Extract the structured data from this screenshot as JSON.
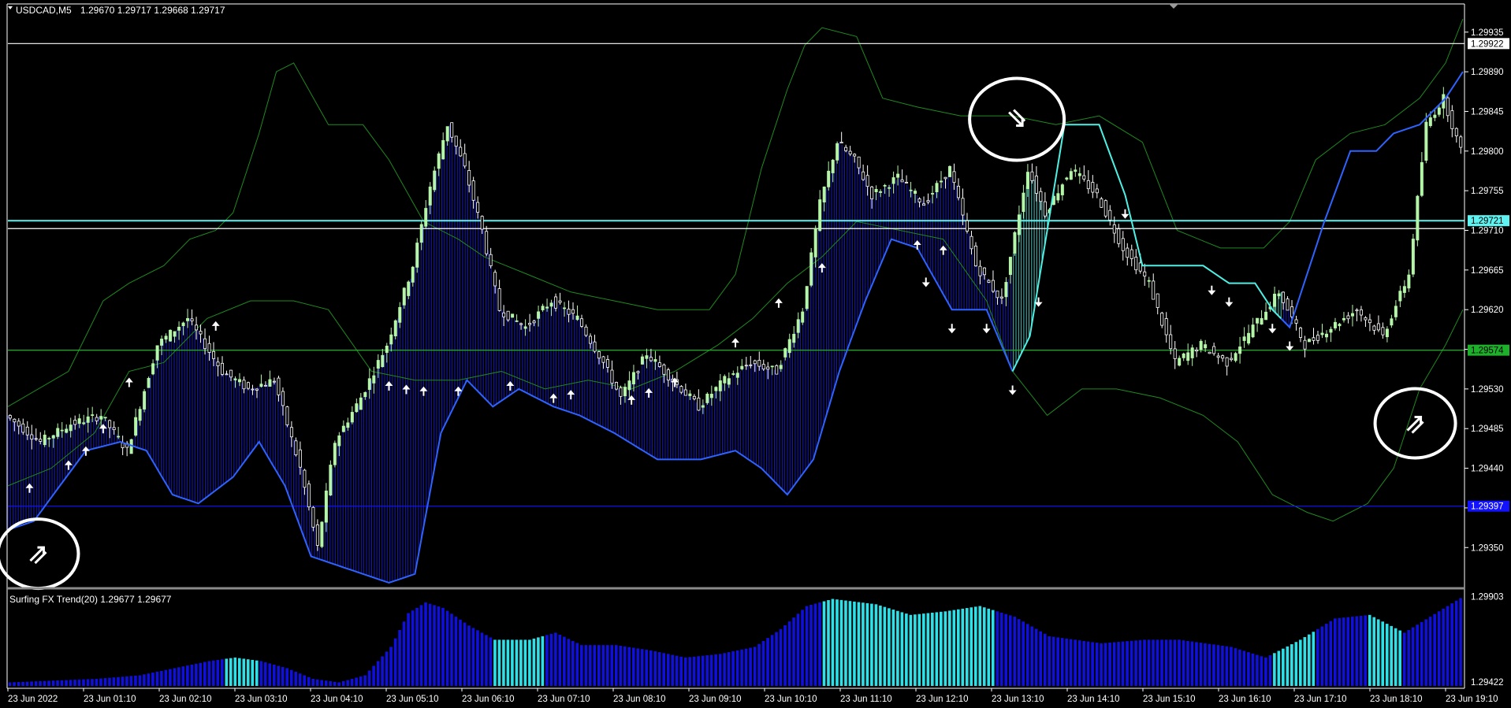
{
  "header": {
    "symbol": "USDCAD,M5",
    "quotes": "1.29670 1.29717 1.29668 1.29717"
  },
  "indicator": {
    "label": "Surfing FX Trend(20) 1.29677 1.29677"
  },
  "colors": {
    "background": "#000000",
    "axis": "#ffffff",
    "bull_candle": "#b4f5a8",
    "bear_candle": "#ffffff",
    "bollinger": "#1f8a1f",
    "cloud_blue": "#1a1fd6",
    "cloud_cyan": "#53e0dc",
    "trend_line_blue": "#2f63ff",
    "trend_line_cyan": "#4ef0e4",
    "hline_white": "#ffffff",
    "hline_cyan": "#5ef3f0",
    "hline_green": "#1eb02a",
    "hline_blue": "#1212ff",
    "hist_blue": "#1010dc",
    "hist_cyan": "#2ee0e8"
  },
  "chart_data": {
    "type": "candlestick",
    "price_axis": {
      "ticks": [
        "1.29935",
        "1.29890",
        "1.29845",
        "1.29800",
        "1.29755",
        "1.29710",
        "1.29665",
        "1.29620",
        "1.29575",
        "1.29530",
        "1.29485",
        "1.29440",
        "1.29395",
        "1.29350"
      ],
      "ylim": [
        1.2931,
        1.2995
      ]
    },
    "indicator_axis": {
      "ticks": [
        "1.29903",
        "1.29422"
      ],
      "ylim": [
        1.294,
        1.2991
      ]
    },
    "time_axis": {
      "ticks": [
        "23 Jun 2022",
        "23 Jun 01:10",
        "23 Jun 02:10",
        "23 Jun 03:10",
        "23 Jun 04:10",
        "23 Jun 05:10",
        "23 Jun 06:10",
        "23 Jun 07:10",
        "23 Jun 08:10",
        "23 Jun 09:10",
        "23 Jun 10:10",
        "23 Jun 11:10",
        "23 Jun 12:10",
        "23 Jun 13:10",
        "23 Jun 14:10",
        "23 Jun 15:10",
        "23 Jun 16:10",
        "23 Jun 17:10",
        "23 Jun 18:10",
        "23 Jun 19:10"
      ]
    },
    "price_labels": [
      {
        "text": "1.29922",
        "value": 1.29922,
        "style": "white"
      },
      {
        "text": "1.29721",
        "value": 1.29721,
        "style": "cyan"
      },
      {
        "text": "1.29574",
        "value": 1.29574,
        "style": "green"
      },
      {
        "text": "1.29397",
        "value": 1.29397,
        "style": "blue"
      }
    ],
    "horizontal_lines": [
      {
        "value": 1.29922,
        "style": "white"
      },
      {
        "value": 1.29721,
        "style": "cyan"
      },
      {
        "value": 1.29712,
        "style": "white"
      },
      {
        "value": 1.29574,
        "style": "green"
      },
      {
        "value": 1.29397,
        "style": "blue"
      }
    ],
    "close_path": [
      [
        0,
        1.295
      ],
      [
        8,
        1.2947
      ],
      [
        15,
        1.2949
      ],
      [
        22,
        1.295
      ],
      [
        28,
        1.2946
      ],
      [
        35,
        1.2958
      ],
      [
        42,
        1.2961
      ],
      [
        50,
        1.2955
      ],
      [
        56,
        1.2953
      ],
      [
        62,
        1.2954
      ],
      [
        68,
        1.2944
      ],
      [
        72,
        1.2935
      ],
      [
        76,
        1.2947
      ],
      [
        82,
        1.2952
      ],
      [
        88,
        1.2958
      ],
      [
        94,
        1.2967
      ],
      [
        98,
        1.2976
      ],
      [
        102,
        1.2983
      ],
      [
        106,
        1.2978
      ],
      [
        110,
        1.2971
      ],
      [
        114,
        1.2962
      ],
      [
        120,
        1.296
      ],
      [
        126,
        1.2963
      ],
      [
        132,
        1.2961
      ],
      [
        138,
        1.2956
      ],
      [
        142,
        1.2952
      ],
      [
        148,
        1.2957
      ],
      [
        154,
        1.2954
      ],
      [
        160,
        1.2951
      ],
      [
        166,
        1.2954
      ],
      [
        172,
        1.2956
      ],
      [
        178,
        1.2955
      ],
      [
        184,
        1.2962
      ],
      [
        188,
        1.2974
      ],
      [
        192,
        1.2981
      ],
      [
        196,
        1.2979
      ],
      [
        200,
        1.2975
      ],
      [
        206,
        1.2977
      ],
      [
        212,
        1.2974
      ],
      [
        218,
        1.2978
      ],
      [
        224,
        1.2967
      ],
      [
        230,
        1.2963
      ],
      [
        236,
        1.2978
      ],
      [
        240,
        1.2973
      ],
      [
        246,
        1.2978
      ],
      [
        252,
        1.2975
      ],
      [
        258,
        1.2969
      ],
      [
        264,
        1.2965
      ],
      [
        270,
        1.2956
      ],
      [
        276,
        1.2958
      ],
      [
        282,
        1.2956
      ],
      [
        288,
        1.296
      ],
      [
        294,
        1.2964
      ],
      [
        300,
        1.2958
      ],
      [
        306,
        1.296
      ],
      [
        312,
        1.2962
      ],
      [
        318,
        1.2959
      ],
      [
        324,
        1.2966
      ],
      [
        328,
        1.2983
      ],
      [
        332,
        1.2986
      ],
      [
        336,
        1.298
      ]
    ],
    "bollinger_upper": [
      [
        0,
        1.2951
      ],
      [
        14,
        1.2955
      ],
      [
        22,
        1.2963
      ],
      [
        28,
        1.2965
      ],
      [
        36,
        1.2967
      ],
      [
        42,
        1.297
      ],
      [
        48,
        1.2971
      ],
      [
        52,
        1.2973
      ],
      [
        58,
        1.2982
      ],
      [
        62,
        1.2989
      ],
      [
        66,
        1.299
      ],
      [
        74,
        1.2983
      ],
      [
        82,
        1.2983
      ],
      [
        88,
        1.2979
      ],
      [
        96,
        1.2972
      ],
      [
        104,
        1.297
      ],
      [
        110,
        1.2968
      ],
      [
        120,
        1.2966
      ],
      [
        130,
        1.2964
      ],
      [
        140,
        1.2963
      ],
      [
        150,
        1.2962
      ],
      [
        162,
        1.2962
      ],
      [
        168,
        1.2966
      ],
      [
        174,
        1.2978
      ],
      [
        180,
        1.2987
      ],
      [
        184,
        1.2992
      ],
      [
        188,
        1.2994
      ],
      [
        196,
        1.2993
      ],
      [
        202,
        1.2986
      ],
      [
        210,
        1.2985
      ],
      [
        220,
        1.2984
      ],
      [
        232,
        1.2984
      ],
      [
        242,
        1.2983
      ],
      [
        252,
        1.2984
      ],
      [
        262,
        1.2981
      ],
      [
        270,
        1.2971
      ],
      [
        280,
        1.2969
      ],
      [
        290,
        1.2969
      ],
      [
        296,
        1.2972
      ],
      [
        302,
        1.2979
      ],
      [
        310,
        1.2982
      ],
      [
        318,
        1.2983
      ],
      [
        326,
        1.2986
      ],
      [
        332,
        1.299
      ],
      [
        336,
        1.2995
      ]
    ],
    "bollinger_lower": [
      [
        0,
        1.2942
      ],
      [
        10,
        1.2944
      ],
      [
        20,
        1.2948
      ],
      [
        28,
        1.2955
      ],
      [
        36,
        1.2956
      ],
      [
        46,
        1.2961
      ],
      [
        56,
        1.2963
      ],
      [
        66,
        1.2963
      ],
      [
        74,
        1.2962
      ],
      [
        84,
        1.2955
      ],
      [
        94,
        1.2954
      ],
      [
        104,
        1.2954
      ],
      [
        114,
        1.2955
      ],
      [
        124,
        1.2953
      ],
      [
        134,
        1.2954
      ],
      [
        144,
        1.2953
      ],
      [
        154,
        1.2955
      ],
      [
        164,
        1.2958
      ],
      [
        172,
        1.2961
      ],
      [
        180,
        1.2965
      ],
      [
        188,
        1.2968
      ],
      [
        196,
        1.2972
      ],
      [
        206,
        1.2971
      ],
      [
        216,
        1.297
      ],
      [
        226,
        1.2963
      ],
      [
        232,
        1.2955
      ],
      [
        240,
        1.295
      ],
      [
        248,
        1.2953
      ],
      [
        256,
        1.2953
      ],
      [
        266,
        1.2952
      ],
      [
        276,
        1.295
      ],
      [
        284,
        1.2947
      ],
      [
        292,
        1.2941
      ],
      [
        300,
        1.2939
      ],
      [
        306,
        1.2938
      ],
      [
        314,
        1.294
      ],
      [
        320,
        1.2944
      ],
      [
        326,
        1.2953
      ],
      [
        332,
        1.2958
      ],
      [
        336,
        1.2962
      ]
    ],
    "trend_line": [
      [
        0,
        1.2937
      ],
      [
        6,
        1.2938
      ],
      [
        12,
        1.2942
      ],
      [
        18,
        1.2946
      ],
      [
        26,
        1.2947
      ],
      [
        32,
        1.2946
      ],
      [
        38,
        1.2941
      ],
      [
        44,
        1.294
      ],
      [
        52,
        1.2943
      ],
      [
        58,
        1.2947
      ],
      [
        64,
        1.2942
      ],
      [
        70,
        1.2934
      ],
      [
        76,
        1.2933
      ],
      [
        82,
        1.2932
      ],
      [
        88,
        1.2931
      ],
      [
        94,
        1.2932
      ],
      [
        100,
        1.2948
      ],
      [
        106,
        1.2954
      ],
      [
        112,
        1.2951
      ],
      [
        118,
        1.2953
      ],
      [
        126,
        1.2951
      ],
      [
        132,
        1.295
      ],
      [
        140,
        1.2948
      ],
      [
        150,
        1.2945
      ],
      [
        160,
        1.2945
      ],
      [
        168,
        1.2946
      ],
      [
        174,
        1.2944
      ],
      [
        180,
        1.2941
      ],
      [
        186,
        1.2945
      ],
      [
        192,
        1.2955
      ],
      [
        198,
        1.2963
      ],
      [
        204,
        1.297
      ],
      [
        210,
        1.2969
      ],
      [
        218,
        1.2962
      ],
      [
        226,
        1.2962
      ],
      [
        232,
        1.2955
      ],
      [
        236,
        1.2959
      ],
      [
        244,
        1.2983
      ],
      [
        252,
        1.2983
      ],
      [
        258,
        1.2975
      ],
      [
        262,
        1.2967
      ],
      [
        268,
        1.2967
      ],
      [
        276,
        1.2967
      ],
      [
        282,
        1.2965
      ],
      [
        288,
        1.2965
      ],
      [
        292,
        1.2962
      ],
      [
        296,
        1.296
      ],
      [
        304,
        1.2972
      ],
      [
        310,
        1.298
      ],
      [
        316,
        1.298
      ],
      [
        320,
        1.2982
      ],
      [
        326,
        1.2983
      ],
      [
        332,
        1.2986
      ],
      [
        336,
        1.2989
      ]
    ],
    "trend_color_segments": [
      [
        0,
        232,
        "blue"
      ],
      [
        232,
        294,
        "cyan"
      ],
      [
        294,
        336,
        "blue"
      ]
    ],
    "buy_arrows": [
      5,
      14,
      18,
      22,
      28,
      48,
      88,
      92,
      96,
      104,
      116,
      126,
      130,
      144,
      148,
      154,
      168,
      178,
      188,
      210,
      216
    ],
    "sell_arrows": [
      212,
      218,
      226,
      232,
      238,
      258,
      278,
      282,
      292,
      296
    ],
    "signal_circles": [
      {
        "x": 7,
        "value": 1.29343,
        "type": "buy"
      },
      {
        "x": 233,
        "value": 1.29836,
        "type": "sell"
      },
      {
        "x": 325,
        "value": 1.29491,
        "type": "buy"
      }
    ],
    "indicator_histogram": {
      "values": [
        [
          0,
          1.2942
        ],
        [
          10,
          1.2943
        ],
        [
          20,
          1.2944
        ],
        [
          30,
          1.2946
        ],
        [
          38,
          1.295
        ],
        [
          46,
          1.2954
        ],
        [
          52,
          1.2956
        ],
        [
          58,
          1.2954
        ],
        [
          64,
          1.295
        ],
        [
          70,
          1.2944
        ],
        [
          76,
          1.2942
        ],
        [
          82,
          1.2946
        ],
        [
          88,
          1.2962
        ],
        [
          92,
          1.2981
        ],
        [
          96,
          1.2987
        ],
        [
          100,
          1.2984
        ],
        [
          106,
          1.2974
        ],
        [
          112,
          1.2966
        ],
        [
          120,
          1.2966
        ],
        [
          126,
          1.297
        ],
        [
          132,
          1.2963
        ],
        [
          140,
          1.2963
        ],
        [
          148,
          1.296
        ],
        [
          156,
          1.2956
        ],
        [
          164,
          1.2958
        ],
        [
          172,
          1.2962
        ],
        [
          178,
          1.2972
        ],
        [
          184,
          1.2985
        ],
        [
          190,
          1.2989
        ],
        [
          200,
          1.2986
        ],
        [
          208,
          1.298
        ],
        [
          216,
          1.2982
        ],
        [
          224,
          1.2985
        ],
        [
          232,
          1.2979
        ],
        [
          240,
          1.2968
        ],
        [
          252,
          1.2964
        ],
        [
          262,
          1.2966
        ],
        [
          270,
          1.2966
        ],
        [
          282,
          1.2962
        ],
        [
          290,
          1.2956
        ],
        [
          298,
          1.2966
        ],
        [
          306,
          1.2978
        ],
        [
          314,
          1.298
        ],
        [
          322,
          1.297
        ],
        [
          330,
          1.2982
        ],
        [
          336,
          1.2991
        ]
      ],
      "color_segments": [
        [
          0,
          50,
          "blue"
        ],
        [
          50,
          58,
          "cyan"
        ],
        [
          58,
          112,
          "blue"
        ],
        [
          112,
          124,
          "cyan"
        ],
        [
          124,
          188,
          "blue"
        ],
        [
          188,
          228,
          "cyan"
        ],
        [
          228,
          292,
          "blue"
        ],
        [
          292,
          302,
          "cyan"
        ],
        [
          302,
          314,
          "blue"
        ],
        [
          314,
          322,
          "cyan"
        ],
        [
          322,
          336,
          "blue"
        ]
      ]
    }
  }
}
